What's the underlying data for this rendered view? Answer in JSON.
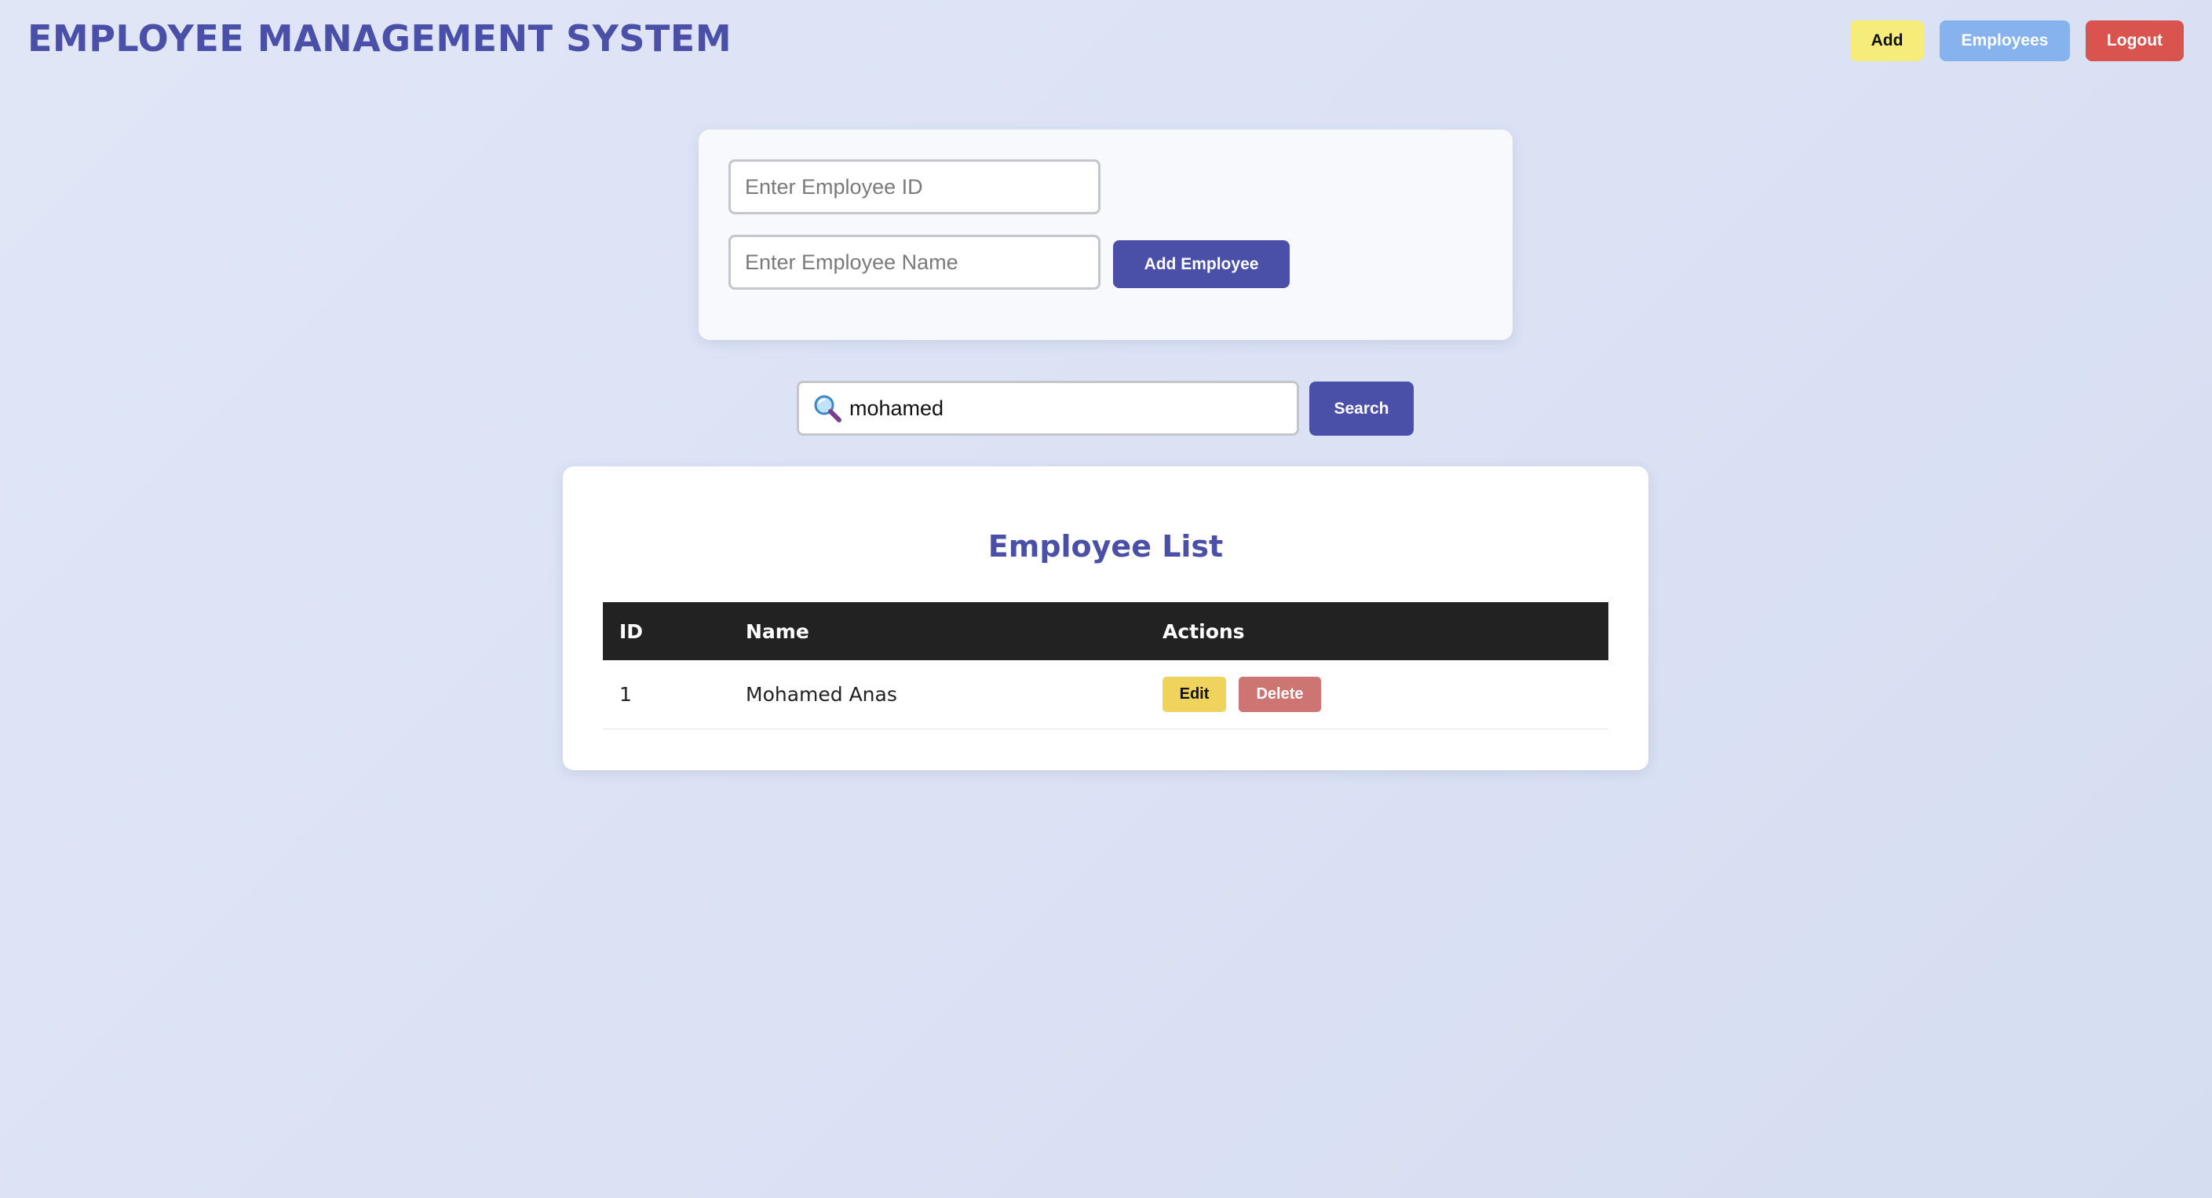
{
  "header": {
    "title": "EMPLOYEE MANAGEMENT SYSTEM",
    "nav": {
      "add_label": "Add",
      "employees_label": "Employees",
      "logout_label": "Logout"
    }
  },
  "add_form": {
    "id_placeholder": "Enter Employee ID",
    "id_value": "",
    "name_placeholder": "Enter Employee Name",
    "name_value": "",
    "submit_label": "Add Employee"
  },
  "search": {
    "value": "mohamed",
    "button_label": "Search",
    "icon": "search-icon"
  },
  "employee_list": {
    "title": "Employee List",
    "columns": [
      "ID",
      "Name",
      "Actions"
    ],
    "rows": [
      {
        "id": "1",
        "name": "Mohamed Anas",
        "edit_label": "Edit",
        "delete_label": "Delete"
      }
    ]
  },
  "colors": {
    "accent": "#4a4fa8",
    "add_button": "#f6ec7a",
    "employees_button": "#86b3ee",
    "logout_button": "#d9544f",
    "edit_button": "#f0d35c",
    "delete_button": "#cd7573",
    "table_header": "#222222"
  }
}
